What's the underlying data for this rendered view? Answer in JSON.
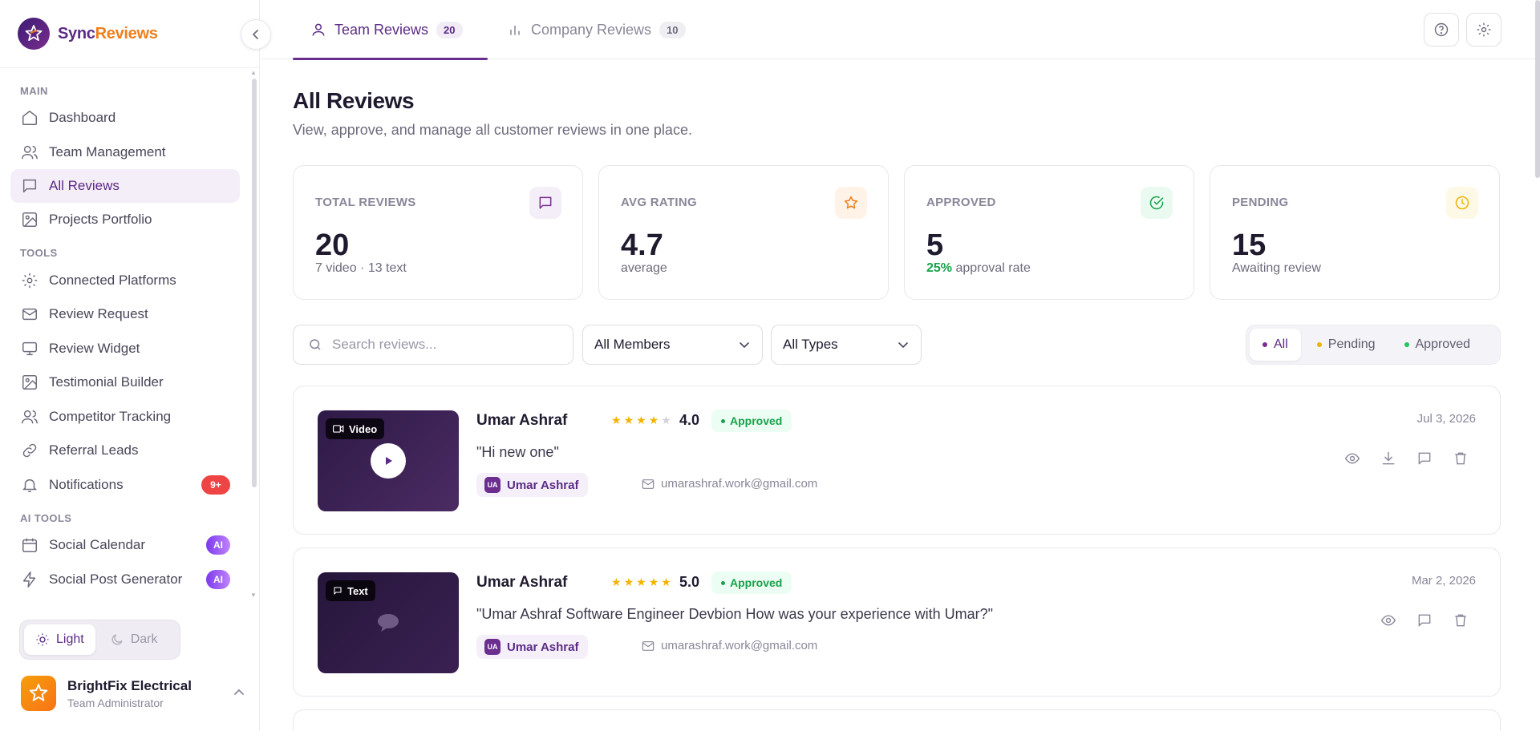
{
  "brand": {
    "part1": "Sync",
    "part2": "Reviews"
  },
  "sidebar": {
    "sections": {
      "main": "MAIN",
      "tools": "TOOLS",
      "ai_tools": "AI TOOLS"
    },
    "items": [
      {
        "label": "Dashboard",
        "icon": "home-icon"
      },
      {
        "label": "Team Management",
        "icon": "users-icon"
      },
      {
        "label": "All Reviews",
        "icon": "message-square-icon",
        "active": true
      },
      {
        "label": "Projects Portfolio",
        "icon": "image-icon"
      },
      {
        "label": "Connected Platforms",
        "icon": "gear-icon"
      },
      {
        "label": "Review Request",
        "icon": "mail-icon"
      },
      {
        "label": "Review Widget",
        "icon": "monitor-icon"
      },
      {
        "label": "Testimonial Builder",
        "icon": "image-icon"
      },
      {
        "label": "Competitor Tracking",
        "icon": "users-icon"
      },
      {
        "label": "Referral Leads",
        "icon": "link-icon"
      },
      {
        "label": "Notifications",
        "icon": "bell-icon",
        "badge": "9+"
      },
      {
        "label": "Social Calendar",
        "icon": "calendar-icon",
        "badge": "AI"
      },
      {
        "label": "Social Post Generator",
        "icon": "zap-icon",
        "badge": "AI"
      }
    ],
    "theme": {
      "light": "Light",
      "dark": "Dark",
      "selected": "Light"
    },
    "user": {
      "name": "BrightFix Electrical",
      "role": "Team Administrator"
    }
  },
  "tabs": [
    {
      "label": "Team Reviews",
      "count": "20",
      "active": true
    },
    {
      "label": "Company Reviews",
      "count": "10",
      "active": false
    }
  ],
  "page": {
    "title": "All Reviews",
    "subtitle": "View, approve, and manage all customer reviews in one place."
  },
  "stats": [
    {
      "label": "TOTAL REVIEWS",
      "value": "20",
      "sub": "7 video · 13 text",
      "icon": "message-square-icon",
      "color": "#7b2e8e"
    },
    {
      "label": "AVG RATING",
      "value": "4.7",
      "sub": "average",
      "icon": "star-icon",
      "color": "#f07f1b"
    },
    {
      "label": "APPROVED",
      "value": "5",
      "sub_highlight": "25%",
      "sub": "approval rate",
      "icon": "check-circle-icon",
      "color": "#16a34a"
    },
    {
      "label": "PENDING",
      "value": "15",
      "sub": "Awaiting review",
      "icon": "clock-icon",
      "color": "#eab308"
    }
  ],
  "filters": {
    "search_placeholder": "Search reviews...",
    "members": "All Members",
    "types": "All Types",
    "status": [
      {
        "label": "All",
        "color": "#7b2e8e",
        "active": true
      },
      {
        "label": "Pending",
        "color": "#eab308",
        "active": false
      },
      {
        "label": "Approved",
        "color": "#22c55e",
        "active": false
      }
    ]
  },
  "reviews": [
    {
      "type": "Video",
      "name": "Umar Ashraf",
      "rating": "4.0",
      "stars": 4,
      "status": "Approved",
      "text": "\"Hi new one\"",
      "member_initials": "UA",
      "member": "Umar Ashraf",
      "email": "umarashraf.work@gmail.com",
      "date": "Jul 3, 2026",
      "actions": [
        "eye-icon",
        "download-icon",
        "message-icon",
        "trash-icon"
      ]
    },
    {
      "type": "Text",
      "name": "Umar Ashraf",
      "rating": "5.0",
      "stars": 5,
      "status": "Approved",
      "text": "\"Umar Ashraf Software Engineer Devbion How was your experience with Umar?\"",
      "member_initials": "UA",
      "member": "Umar Ashraf",
      "email": "umarashraf.work@gmail.com",
      "date": "Mar 2, 2026",
      "actions": [
        "eye-icon",
        "message-icon",
        "trash-icon"
      ]
    }
  ]
}
